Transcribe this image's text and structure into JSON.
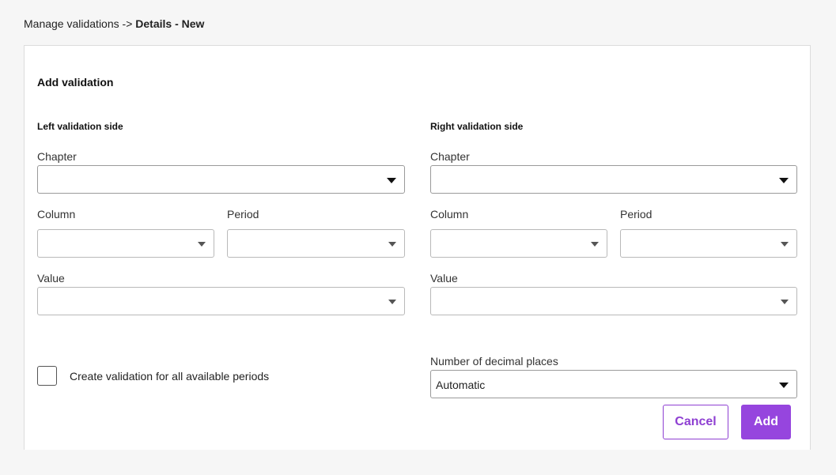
{
  "breadcrumb": {
    "parent": "Manage validations",
    "separator": "->",
    "current": "Details - New"
  },
  "form": {
    "title": "Add validation",
    "left": {
      "title": "Left validation side",
      "chapter_label": "Chapter",
      "chapter_value": "",
      "column_label": "Column",
      "column_value": "",
      "period_label": "Period",
      "period_value": "",
      "value_label": "Value",
      "value_value": ""
    },
    "right": {
      "title": "Right validation side",
      "chapter_label": "Chapter",
      "chapter_value": "",
      "column_label": "Column",
      "column_value": "",
      "period_label": "Period",
      "period_value": "",
      "value_label": "Value",
      "value_value": ""
    },
    "all_periods_checkbox": {
      "label": "Create validation for all available periods",
      "checked": false
    },
    "decimal_places": {
      "label": "Number of decimal places",
      "value": "Automatic"
    },
    "cancel_label": "Cancel",
    "add_label": "Add"
  },
  "colors": {
    "accent": "#9645de",
    "accent_text": "#8e3fd2"
  },
  "icons": {
    "dropdown": "chevron-down-icon"
  }
}
